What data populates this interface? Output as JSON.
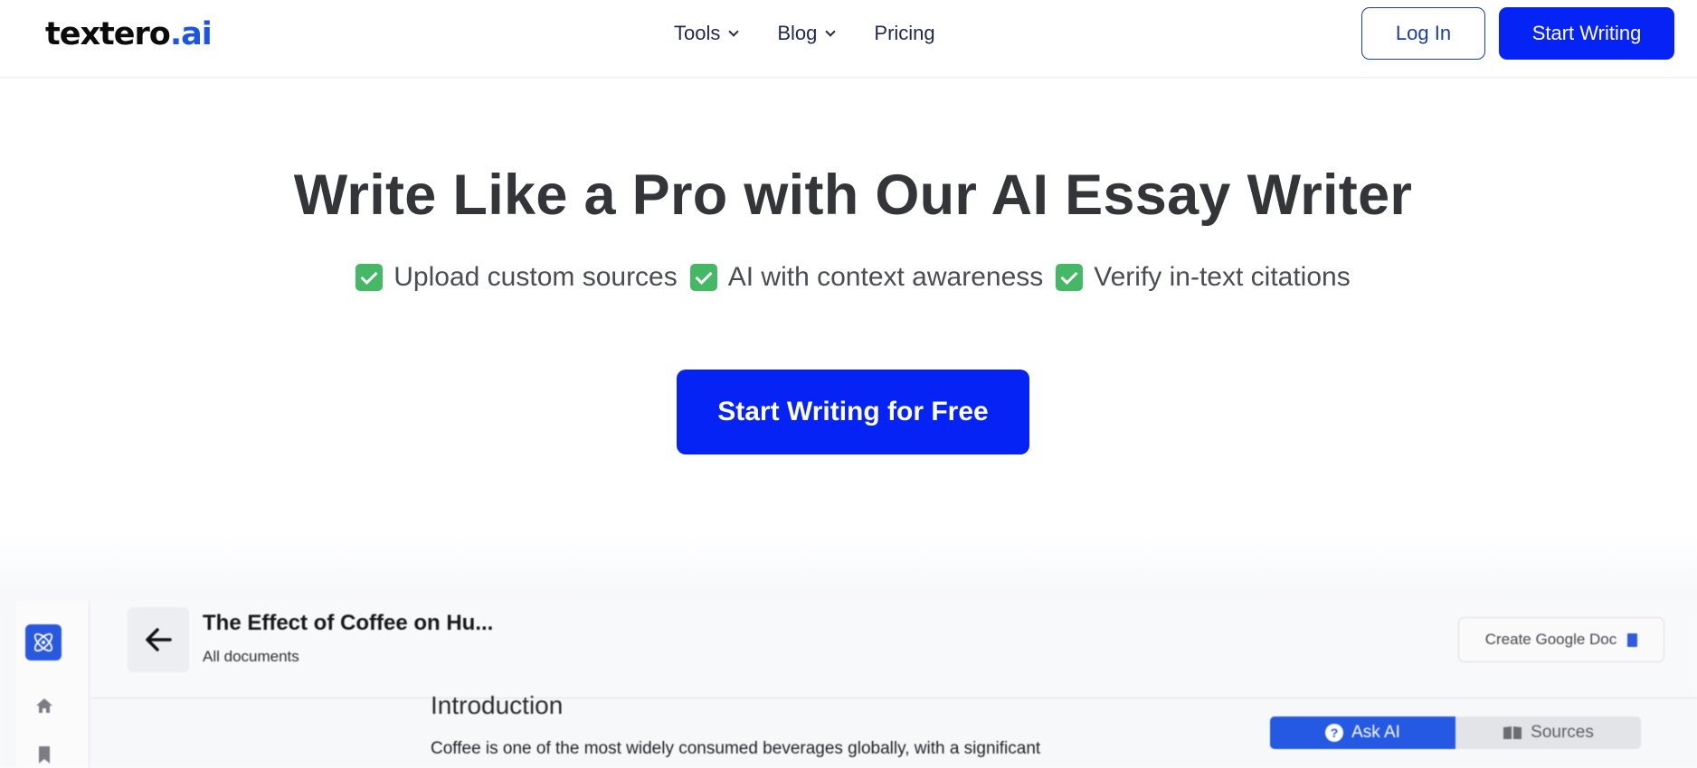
{
  "nav": {
    "logo_main": "textero",
    "logo_accent": ".ai",
    "menu": [
      {
        "label": "Tools"
      },
      {
        "label": "Blog"
      },
      {
        "label": "Pricing"
      }
    ],
    "login_label": "Log In",
    "start_label": "Start Writing"
  },
  "hero": {
    "title": "Write Like a Pro with Our AI Essay Writer",
    "features": [
      "Upload custom sources",
      "AI with context awareness",
      "Verify in-text citations"
    ],
    "cta_label": "Start Writing for Free"
  },
  "app_preview": {
    "doc_title": "The Effect of Coffee on Hu...",
    "doc_subtitle": "All documents",
    "google_doc_label": "Create Google Doc",
    "section_heading": "Introduction",
    "body_text": "Coffee is one of the most widely consumed beverages globally, with a significant",
    "tabs": [
      {
        "label": "Ask AI",
        "icon": "question-icon",
        "active": true
      },
      {
        "label": "Sources",
        "icon": "book-icon",
        "active": false
      }
    ]
  },
  "colors": {
    "brand_blue": "#0523f5",
    "logo_accent": "#1c55e6",
    "check_green": "#45b865",
    "app_accent": "#2558e3"
  }
}
